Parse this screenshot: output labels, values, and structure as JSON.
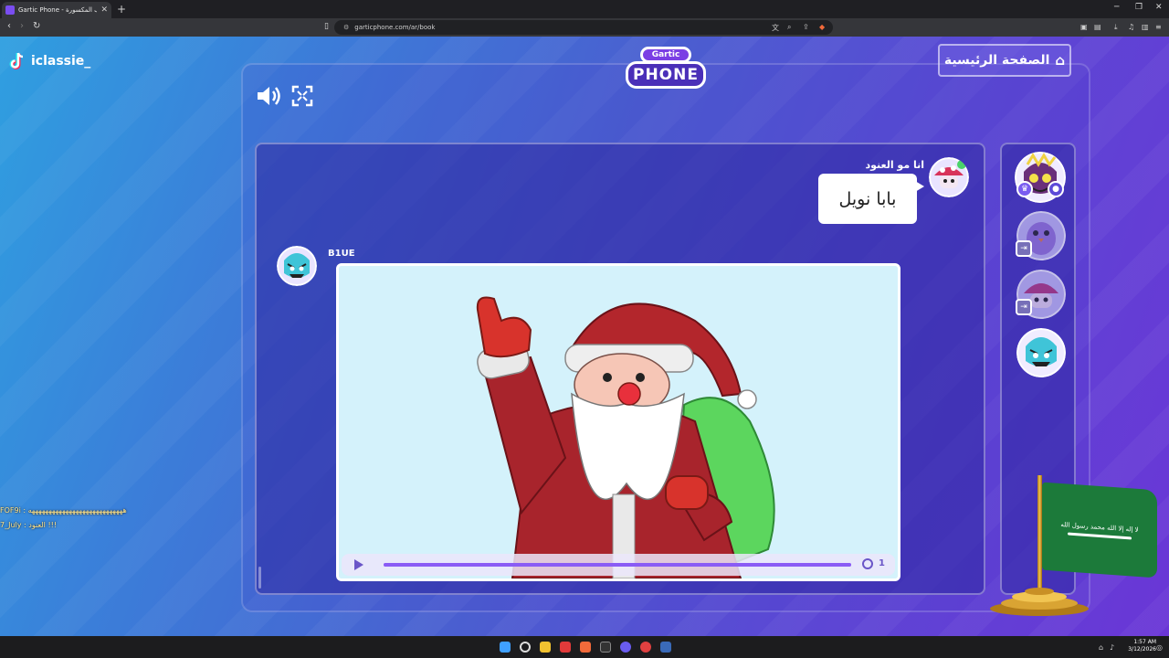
{
  "browser": {
    "tab_title": "Gartic Phone - لعبة الهواتف المكسورة",
    "url": "garticphone.com/ar/book"
  },
  "stream": {
    "streamer_name": "iclassie_",
    "chat": [
      {
        "text": "FOF9i : ههههههههههههههههههههههههههههه"
      },
      {
        "text": "7_July : العنود !!!"
      }
    ]
  },
  "game": {
    "logo_top": "Gartic",
    "logo_bottom": "PHONE",
    "home_button": "الصفحة الرئيسية",
    "message": {
      "author": "انا مو العنود",
      "text": "بابا نويل"
    },
    "drawing": {
      "author": "B1UE"
    },
    "player": {
      "speed": "1",
      "progress": 1.0
    },
    "players": [
      {
        "name": "host-avatar",
        "badge": "crown"
      },
      {
        "name": "pigeon-avatar",
        "badge": "exit"
      },
      {
        "name": "mushroom-avatar",
        "badge": "exit"
      },
      {
        "name": "monster-avatar",
        "badge": ""
      }
    ]
  },
  "overlay": {
    "flag_text": "لا إله إلا الله محمد رسول الله"
  },
  "taskbar": {
    "time": "1:57 AM",
    "date": "3/12/2026"
  }
}
